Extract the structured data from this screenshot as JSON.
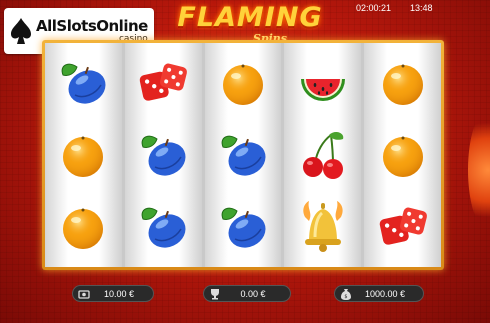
{
  "logo": {
    "main": "AllSlotsOnline",
    "sub": ".casino",
    "icon": "spade-icon"
  },
  "title": {
    "main": "FLAMING",
    "sub": "Spins"
  },
  "clock": {
    "timer": "02:00:21",
    "time": "13:48"
  },
  "reels": [
    [
      "plum",
      "orange",
      "orange"
    ],
    [
      "dice",
      "plum",
      "plum"
    ],
    [
      "orange",
      "plum",
      "plum"
    ],
    [
      "watermelon",
      "cherries",
      "bell"
    ],
    [
      "orange",
      "orange",
      "dice"
    ]
  ],
  "bottom_bar": {
    "bet": {
      "icon": "coins-stack-icon",
      "value": "10.00 €"
    },
    "win": {
      "icon": "trophy-icon",
      "value": "0.00 €"
    },
    "balance": {
      "icon": "money-bag-icon",
      "value": "1000.00 €"
    }
  },
  "colors": {
    "frame": "#e8a02a",
    "background": "#c4200e",
    "title": "#ffd23a"
  }
}
